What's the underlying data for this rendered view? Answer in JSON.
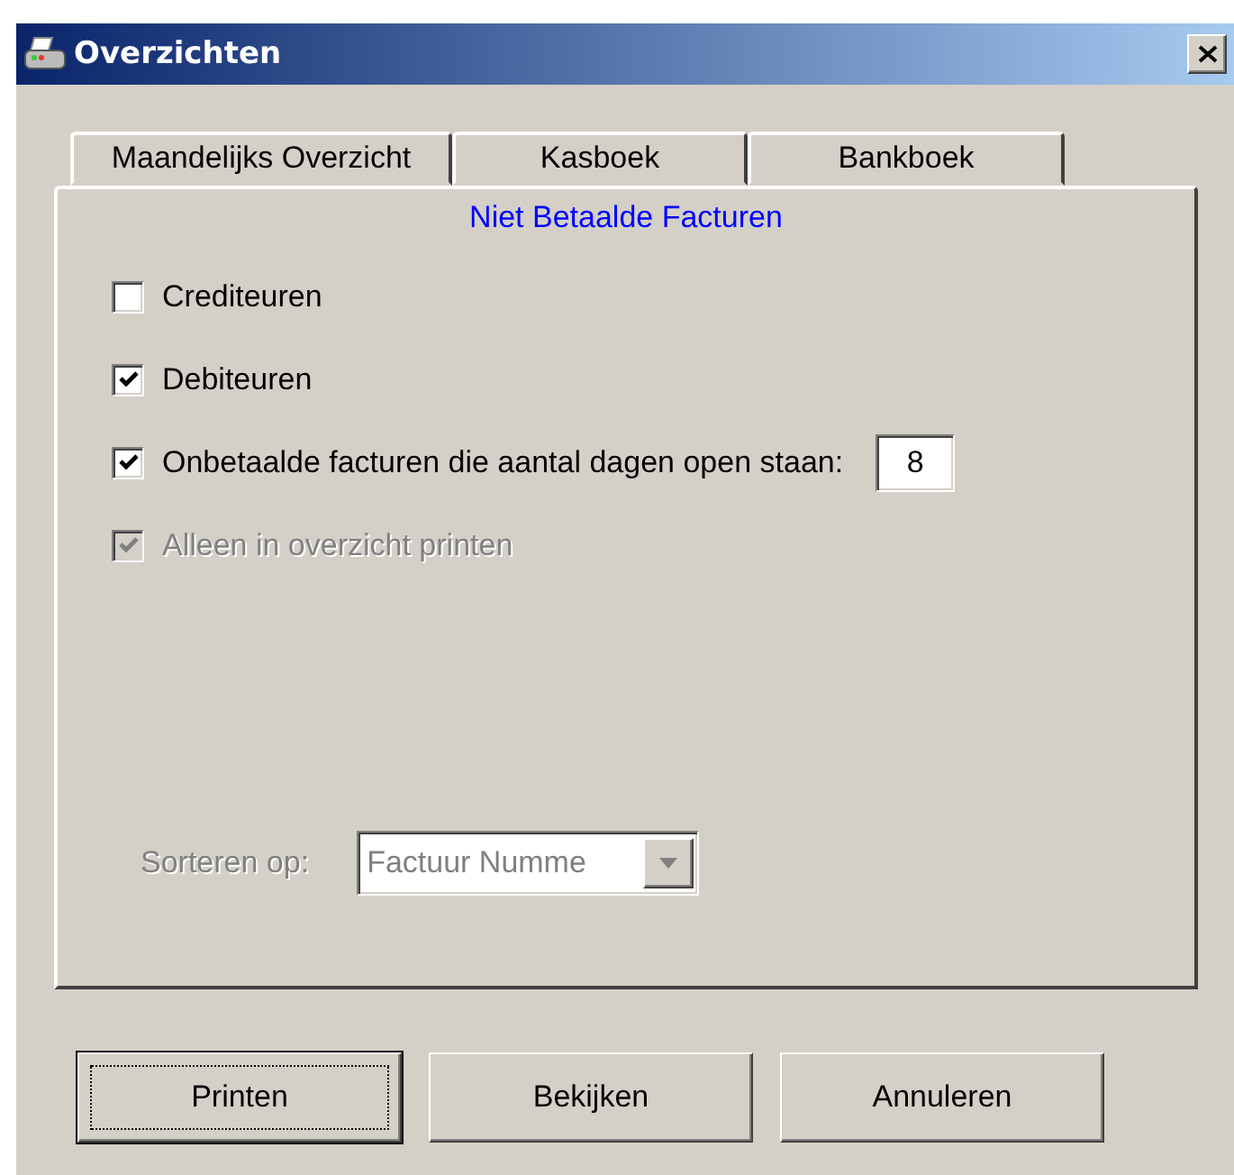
{
  "window": {
    "title": "Overzichten"
  },
  "tabs": [
    {
      "label": "Maandelijks Overzicht",
      "selected": false
    },
    {
      "label": "Kasboek",
      "selected": false
    },
    {
      "label": "Bankboek",
      "selected": false
    },
    {
      "label": "Niet Betaalde Facturen",
      "selected": true
    }
  ],
  "options": [
    {
      "kind": "checkbox",
      "label": "Crediteuren",
      "checked": false,
      "disabled": false
    },
    {
      "kind": "checkbox",
      "label": "Debiteuren",
      "checked": true,
      "disabled": false
    },
    {
      "kind": "checkbox-field",
      "label": "Onbetaalde facturen die aantal dagen open staan:",
      "checked": true,
      "disabled": false,
      "value": "8"
    },
    {
      "kind": "checkbox",
      "label": "Alleen in overzicht printen",
      "checked": true,
      "disabled": true
    }
  ],
  "sort": {
    "label": "Sorteren op:",
    "value": "Factuur Numme",
    "disabled": true
  },
  "buttons": [
    {
      "label": "Printen",
      "focused": true
    },
    {
      "label": "Bekijken",
      "focused": false
    },
    {
      "label": "Annuleren",
      "focused": false
    }
  ]
}
